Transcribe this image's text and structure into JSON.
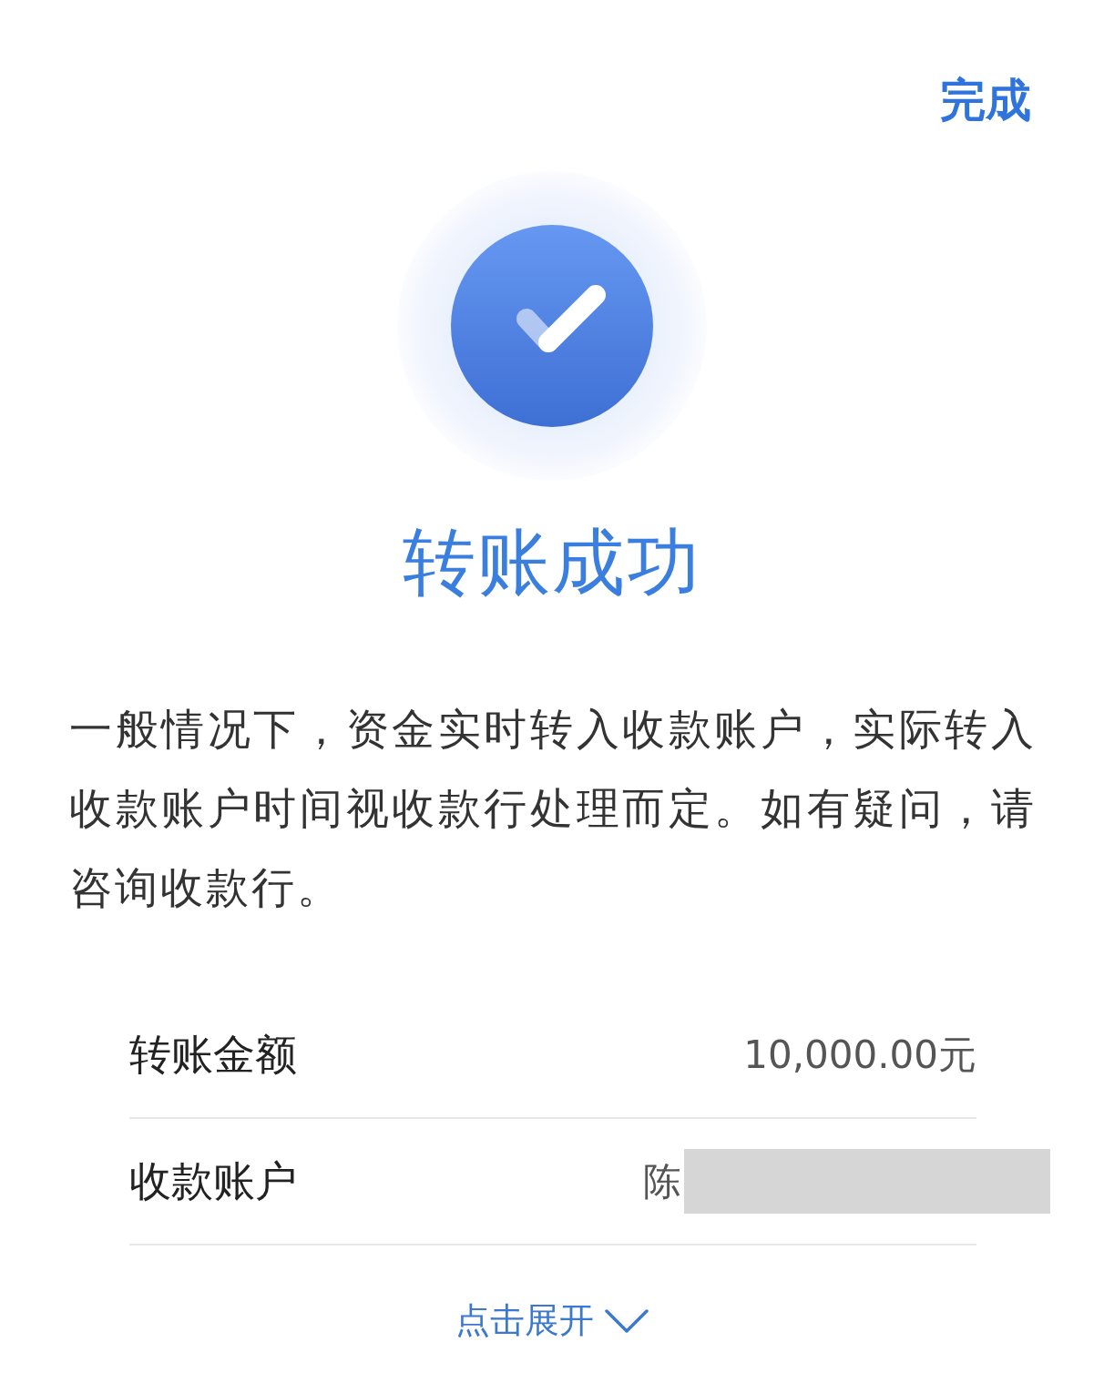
{
  "header": {
    "done_button": "完成"
  },
  "result": {
    "succeeded": true,
    "title": "转账成功",
    "message": "一般情况下，资金实时转入收款账户，实际转入收款账户时间视收款行处理而定。如有疑问，请咨询收款行。"
  },
  "details": [
    {
      "label": "转账金额",
      "value": "10,000.00元",
      "redacted": false
    },
    {
      "label": "收款账户",
      "value": "陈",
      "redacted": true
    }
  ],
  "expand_link": {
    "label": "点击展开",
    "expanded": false
  }
}
